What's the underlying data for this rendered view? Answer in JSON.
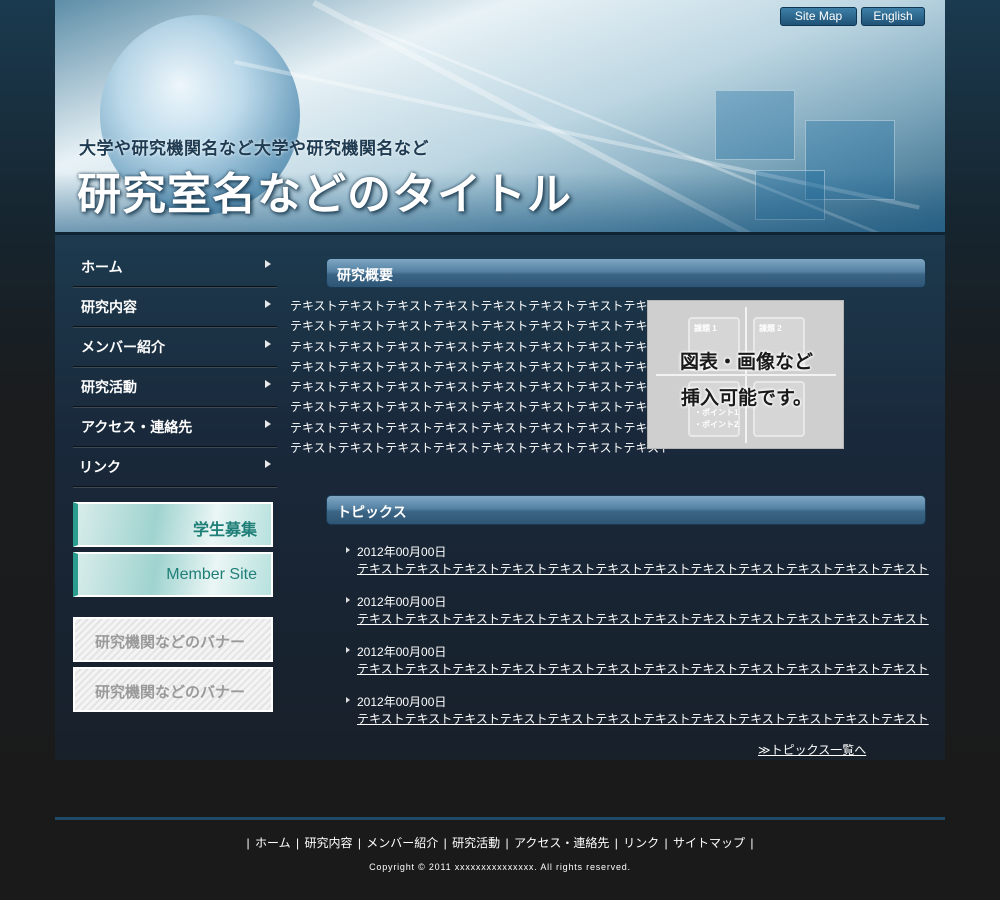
{
  "header": {
    "sitemap_label": "Site Map",
    "english_label": "English",
    "subtitle": "大学や研究機関名など大学や研究機関名など",
    "title": "研究室名などのタイトル"
  },
  "nav": {
    "items": [
      {
        "label": "ホーム"
      },
      {
        "label": "研究内容"
      },
      {
        "label": "メンバー紹介"
      },
      {
        "label": "研究活動"
      },
      {
        "label": "アクセス・連絡先"
      },
      {
        "label": "リンク"
      }
    ]
  },
  "banners": [
    {
      "label": "学生募集"
    },
    {
      "label": "Member Site"
    },
    {
      "label": "研究機関などのバナー"
    },
    {
      "label": "研究機関などのバナー"
    }
  ],
  "overview": {
    "heading": "研究概要",
    "lines": [
      "テキストテキストテキストテキストテキストテキストテキストテキスト",
      "テキストテキストテキストテキストテキストテキストテキストテキスト",
      "テキストテキストテキストテキストテキストテキストテキストテキスト",
      "テキストテキストテキストテキストテキストテキストテキストテキスト",
      "テキストテキストテキストテキストテキストテキストテキストテキスト",
      "テキストテキストテキストテキストテキストテキストテキストテキスト",
      "テキストテキストテキストテキストテキストテキストテキストテキスト",
      "テキストテキストテキストテキストテキストテキストテキストテキスト"
    ],
    "figure": {
      "line1": "図表・画像など",
      "line2": "挿入可能です。",
      "ghost_title1": "課題 1",
      "ghost_title2": "課題 2",
      "ghost_point1": "・ポイント1",
      "ghost_point2": "・ポイント2"
    }
  },
  "topics": {
    "heading": "トピックス",
    "items": [
      {
        "date": "2012年00月00日",
        "text": "テキストテキストテキストテキストテキストテキストテキストテキストテキストテキストテキストテキスト"
      },
      {
        "date": "2012年00月00日",
        "text": "テキストテキストテキストテキストテキストテキストテキストテキストテキストテキストテキストテキスト"
      },
      {
        "date": "2012年00月00日",
        "text": "テキストテキストテキストテキストテキストテキストテキストテキストテキストテキストテキストテキスト"
      },
      {
        "date": "2012年00月00日",
        "text": "テキストテキストテキストテキストテキストテキストテキストテキストテキストテキストテキストテキスト"
      }
    ],
    "more_label": "≫トピックス一覧へ"
  },
  "footer": {
    "links": [
      "ホーム",
      "研究内容",
      "メンバー紹介",
      "研究活動",
      "アクセス・連絡先",
      "リンク",
      "サイトマップ"
    ],
    "separator": "|",
    "copyright": "Copyright © 2011 xxxxxxxxxxxxxxx. All rights reserved."
  },
  "colors": {
    "accent": "#3c6686",
    "banner_green": "#2a9d8f"
  }
}
